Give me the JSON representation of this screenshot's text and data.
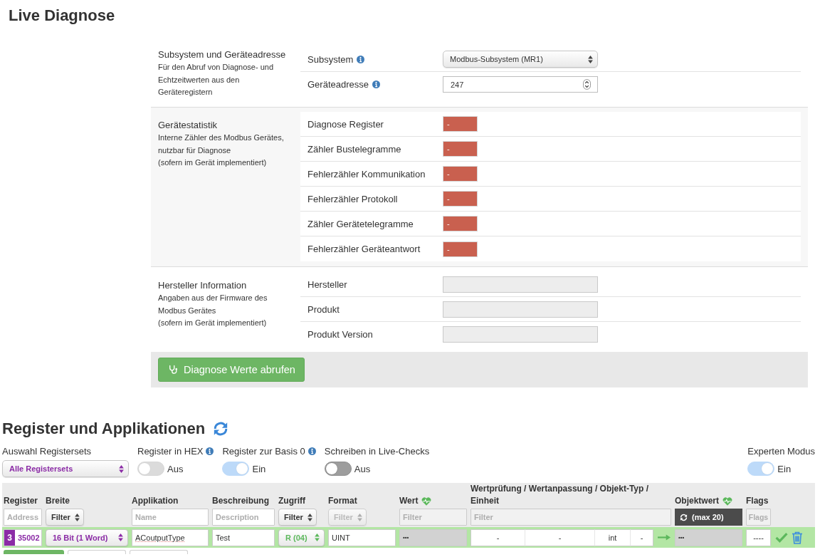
{
  "page_title": "Live Diagnose",
  "diagnose": {
    "sections": [
      {
        "kind": "device",
        "title": "Subsystem und Geräteadresse",
        "description": [
          "Für den Abruf von Diagnose- und",
          "Echtzeitwerten aus den",
          "Geräteregistern"
        ],
        "rows": [
          {
            "kind": "select",
            "label": "Subsystem",
            "info": true,
            "value": "Modbus-Subsystem (MR1)"
          },
          {
            "kind": "number",
            "label": "Geräteadresse",
            "info": true,
            "value": "247"
          }
        ]
      },
      {
        "kind": "statistics",
        "title": "Gerätestatistik",
        "description": [
          "Interne Zähler des Modbus Gerätes,",
          "nutzbar für Diagnose",
          "(sofern im Gerät implementiert)"
        ],
        "rows": [
          {
            "kind": "status",
            "label": "Diagnose Register",
            "value": "-",
            "error": true
          },
          {
            "kind": "status",
            "label": "Zähler Bustelegramme",
            "value": "-",
            "error": true
          },
          {
            "kind": "status",
            "label": "Fehlerzähler Kommunikation",
            "value": "-",
            "error": true
          },
          {
            "kind": "status",
            "label": "Fehlerzähler Protokoll",
            "value": "-",
            "error": true
          },
          {
            "kind": "status",
            "label": "Zähler Gerätetelegramme",
            "value": "-",
            "error": true
          },
          {
            "kind": "status",
            "label": "Fehlerzähler Geräteantwort",
            "value": "-",
            "error": true
          }
        ]
      },
      {
        "kind": "info",
        "title": "Hersteller Information",
        "description": [
          "Angaben aus der Firmware des",
          "Modbus Gerätes",
          "(sofern im Gerät implementiert)"
        ],
        "rows": [
          {
            "kind": "readonly",
            "label": "Hersteller"
          },
          {
            "kind": "readonly",
            "label": "Produkt"
          },
          {
            "kind": "readonly",
            "label": "Produkt Version"
          }
        ]
      }
    ],
    "action_button": "Diagnose Werte abrufen"
  },
  "registers": {
    "title": "Register und Applikationen",
    "controls": [
      {
        "kind": "select",
        "label": "Auswahl Registersets",
        "value": "Alle Registersets"
      },
      {
        "kind": "toggle",
        "label": "Register in HEX",
        "info": true,
        "on": false,
        "disabled": true,
        "state_text": "Aus"
      },
      {
        "kind": "toggle",
        "label": "Register zur Basis 0",
        "info": true,
        "on": true,
        "disabled": true,
        "state_text": "Ein"
      },
      {
        "kind": "toggle",
        "label": "Schreiben in Live-Checks",
        "on": false,
        "disabled": false,
        "state_text": "Aus"
      },
      {
        "kind": "toggle",
        "label": "Experten Modus",
        "on": true,
        "disabled": true,
        "state_text": "Ein"
      }
    ],
    "table": {
      "columns": [
        {
          "label": "Register",
          "filter": {
            "kind": "input",
            "placeholder": "Address",
            "disabled": false
          }
        },
        {
          "label": "Breite",
          "filter": {
            "kind": "select",
            "value": "Filter",
            "disabled": false
          }
        },
        {
          "label": "Applikation",
          "filter": {
            "kind": "input",
            "placeholder": "Name",
            "disabled": false
          }
        },
        {
          "label": "Beschreibung",
          "filter": {
            "kind": "input",
            "placeholder": "Description",
            "disabled": false
          }
        },
        {
          "label": "Zugriff",
          "filter": {
            "kind": "select",
            "value": "Filter",
            "disabled": false
          }
        },
        {
          "label": "Format",
          "filter": {
            "kind": "select",
            "value": "Filter",
            "disabled": true
          }
        },
        {
          "label": "Wert",
          "live": true,
          "filter": {
            "kind": "input",
            "placeholder": "Filter",
            "disabled": true
          }
        },
        {
          "label": "Wertprüfung / Wertanpassung / Objekt-Typ / Einheit",
          "filter": {
            "kind": "input",
            "placeholder": "Filter",
            "disabled": true
          }
        },
        {
          "label": "Objektwert",
          "live": true,
          "filter": {
            "kind": "button",
            "label": "(max 20)"
          }
        },
        {
          "label": "Flags",
          "filter": {
            "kind": "input",
            "placeholder": "Flags",
            "disabled": true
          }
        }
      ],
      "rows": [
        {
          "selected": true,
          "color": "#8b2ba6",
          "set": "3",
          "address": "35002",
          "width": "16 Bit (1 Word)",
          "application": "ACoutputType",
          "description": "Test",
          "access": {
            "value": "R (04)",
            "read_only": true
          },
          "format": "UINT",
          "value": "•••",
          "checks": [
            "-",
            "-",
            "int",
            "-"
          ],
          "object_value": "•••",
          "flags": "----"
        }
      ]
    },
    "bottom_buttons": [
      {
        "kind": "primary"
      },
      {
        "kind": "default"
      },
      {
        "kind": "default"
      }
    ]
  }
}
